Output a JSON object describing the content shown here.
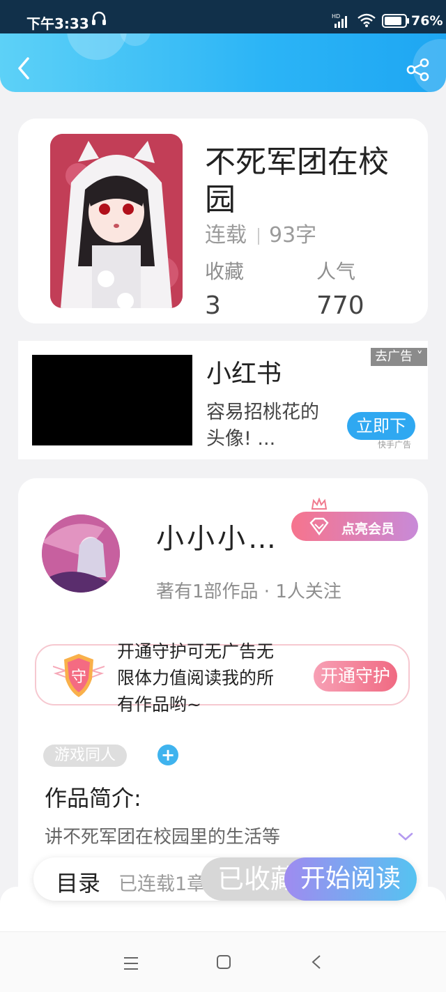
{
  "status_bar": {
    "time": "下午3:33",
    "battery": "76%",
    "network_badge": "HD"
  },
  "header": {
    "back_icon": "chevron-left-icon",
    "share_icon": "share-icon"
  },
  "book": {
    "title": "不死军团在校园",
    "status": "连载",
    "word_count": "93字",
    "favorites_label": "收藏",
    "favorites_value": "3",
    "popularity_label": "人气",
    "popularity_value": "770"
  },
  "ad": {
    "title": "小红书",
    "description": "容易招桃花的头像! ...",
    "close_label": "去广告",
    "cta_label": "立即下",
    "source": "快手广告"
  },
  "author": {
    "name": "小小小…",
    "vip_label": "点亮会员",
    "stats": "著有1部作品 · 1人关注",
    "guard_icon_label": "守",
    "guard_text": "开通守护可无广告无限体力值阅读我的所有作品哟~",
    "guard_button": "开通守护",
    "tag": "游戏同人",
    "tag_add": "+",
    "intro_title": "作品简介:",
    "intro_text": "讲不死军团在校园里的生活等"
  },
  "action_bar": {
    "toc_label": "目录",
    "serial_info": "已连载1章",
    "favorite_label": "已收藏",
    "read_label": "开始阅读"
  },
  "colors": {
    "header_accent": "#2bb4f6",
    "read_gradient_start": "#9f8bf0",
    "read_gradient_end": "#55c3f1",
    "vip_pink": "#f6748d",
    "guard_red": "#f06a82"
  }
}
